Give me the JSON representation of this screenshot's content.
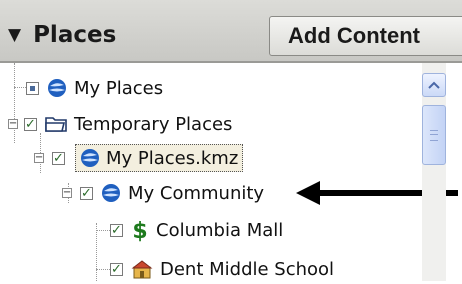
{
  "header": {
    "title": "Places",
    "collapse_glyph": "▼",
    "add_content_label": "Add Content"
  },
  "tree": {
    "items": [
      {
        "label": "My Places",
        "checked": false,
        "icon": "globe-icon",
        "level": 0
      },
      {
        "label": "Temporary Places",
        "checked": true,
        "icon": "folder-icon",
        "level": 0,
        "expander": "−"
      },
      {
        "label": "My Places.kmz",
        "checked": true,
        "icon": "globe-icon",
        "level": 1,
        "expander": "−",
        "selected": true
      },
      {
        "label": "My Community",
        "checked": true,
        "icon": "globe-icon",
        "level": 2,
        "expander": "−"
      },
      {
        "label": "Columbia Mall",
        "checked": true,
        "icon": "dollar-sign-icon",
        "level": 3
      },
      {
        "label": "Dent Middle School",
        "checked": true,
        "icon": "school-icon",
        "level": 3
      }
    ]
  },
  "colors": {
    "header_bg": "#d0d0cc",
    "selection_bg": "#f3efdf",
    "globe_blue": "#1f5fbf",
    "dollar_green": "#1d7a1d"
  }
}
